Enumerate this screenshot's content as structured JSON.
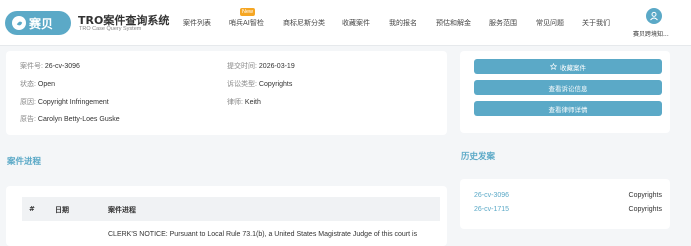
{
  "nav": {
    "logo_text": "赛贝",
    "brand_title": "TRO案件查询系统",
    "brand_subtitle": "TRO Case Query System",
    "menu": [
      {
        "label": "案件列表"
      },
      {
        "label": "哨兵AI智检"
      },
      {
        "label": "商标尼斯分类"
      },
      {
        "label": "收藏案件"
      },
      {
        "label": "我的报名"
      },
      {
        "label": "预估和解金"
      },
      {
        "label": "服务范围"
      },
      {
        "label": "常见问题"
      },
      {
        "label": "关于我们"
      }
    ],
    "new_badge": "New",
    "user_name": "赛贝跨境知..."
  },
  "case": {
    "number_label": "案件号:",
    "number": "26-cv-3096",
    "submit_label": "提交时间:",
    "submit_time": "2026-03-19",
    "status_label": "状态:",
    "status": "Open",
    "type_label": "诉讼类型:",
    "type": "Copyrights",
    "reason_label": "原因:",
    "reason": "Copyright Infringement",
    "lawyer_label": "律师:",
    "lawyer": "Keith",
    "plaintiff_label": "原告:",
    "plaintiff": "Carolyn Betty-Loes Guske"
  },
  "actions": {
    "favorite": "收藏案件",
    "litigation_info": "查看诉讼信息",
    "lawyer_detail": "查看律师详情"
  },
  "progress": {
    "title": "案件进程",
    "headers": {
      "index": "#",
      "date": "日期",
      "progress": "案件进程"
    },
    "first_text": "CLERK'S NOTICE: Pursuant to Local Rule 73.1(b), a United States Magistrate Judge of this court is"
  },
  "history": {
    "title": "历史发案",
    "items": [
      {
        "id": "26-cv-3096",
        "type": "Copyrights"
      },
      {
        "id": "26-cv-1715",
        "type": "Copyrights"
      }
    ]
  },
  "colors": {
    "accent": "#5ba9c7",
    "badge": "#f5a623"
  },
  "icons": {
    "favorite": "star-icon",
    "user": "user-icon",
    "logo": "logo-icon"
  }
}
